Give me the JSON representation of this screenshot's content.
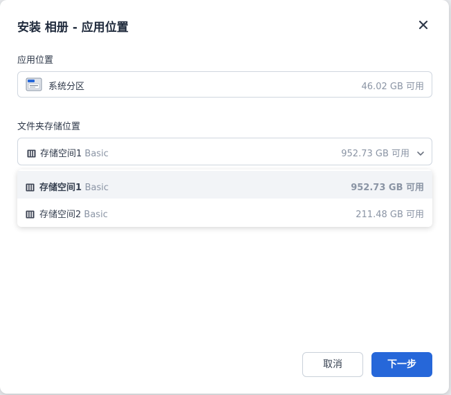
{
  "dialog": {
    "title": "安装 相册 - 应用位置"
  },
  "app_location": {
    "label": "应用位置",
    "value": "系统分区",
    "free": "46.02 GB 可用",
    "icon": "ssd-icon"
  },
  "folder_location": {
    "label": "文件夹存储位置",
    "selected": {
      "name": "存储空间1",
      "type": "Basic",
      "free": "952.73 GB 可用"
    },
    "options": [
      {
        "name": "存储空间1",
        "type": "Basic",
        "free": "952.73 GB 可用",
        "selected": true
      },
      {
        "name": "存储空间2",
        "type": "Basic",
        "free": "211.48 GB 可用",
        "selected": false
      }
    ]
  },
  "buttons": {
    "cancel": "取消",
    "next": "下一步"
  },
  "colors": {
    "primary": "#2667d9",
    "muted_text": "#8a94a4",
    "selected_row": "#f2f4f7"
  }
}
